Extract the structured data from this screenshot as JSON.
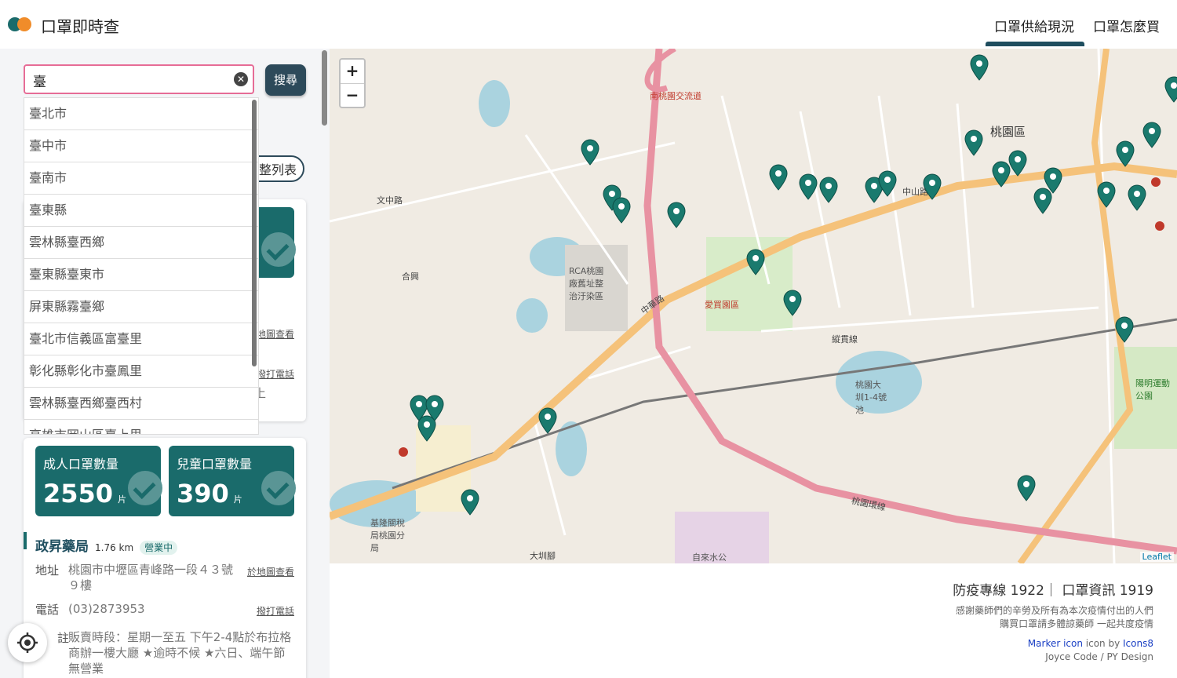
{
  "app": {
    "title": "口罩即時查"
  },
  "nav": {
    "items": [
      "口罩供給現況",
      "口罩怎麼買"
    ]
  },
  "search": {
    "value": "臺",
    "button_label": "搜尋"
  },
  "autocomplete": {
    "items": [
      "臺北市",
      "臺中市",
      "臺南市",
      "臺東縣",
      "雲林縣臺西鄉",
      "臺東縣臺東市",
      "屏東縣霧臺鄉",
      "臺北市信義區富臺里",
      "彰化縣彰化市臺鳳里",
      "雲林縣臺西鄉臺西村",
      "高雄市岡山區臺上里"
    ]
  },
  "list_toggle": {
    "label": "整列表"
  },
  "partial_card": {
    "map_link": "地圖查看",
    "call_link": "撥打電話",
    "note_tail": "上"
  },
  "pharmacy": {
    "adult_label": "成人口罩數量",
    "adult_count": "2550",
    "child_label": "兒童口罩數量",
    "child_count": "390",
    "unit": "片",
    "name": "政昇藥局",
    "distance": "1.76 km",
    "status": "營業中",
    "address_label": "地址",
    "address": "桃園市中壢區青峰路一段４３號９樓",
    "map_link": "於地圖查看",
    "phone_label": "電話",
    "phone": "(03)2873953",
    "call_link": "撥打電話",
    "note_label": "註",
    "note": "販賣時段：星期一至五 下午2-4點於布拉格商辦一樓大廳 ★逾時不候 ★六日、端午節無營業"
  },
  "map": {
    "zoom_in": "+",
    "zoom_out": "−",
    "attribution": "Leaflet",
    "labels": [
      "桃園區",
      "中山路",
      "中華路",
      "桃園環線",
      "縱貫線",
      "南桃園交流道",
      "RCA桃園廠舊址整治汙染區",
      "桃園大圳1-4號池",
      "愛買園區",
      "文中路",
      "合興",
      "大圳腳",
      "陽明運動公園",
      "基隆關稅局桃園分局",
      "自來水公"
    ],
    "markers": 34
  },
  "footer": {
    "hotline": "防疫專線 1922｜ 口罩資訊 1919",
    "thanks_1": "感謝藥師們的辛勞及所有為本次疫情付出的人們",
    "thanks_2": "購買口罩請多體諒藥師 一起共度疫情",
    "credit_marker": "Marker icon",
    "credit_by": " icon by ",
    "credit_icons8": "Icons8",
    "credit_design": "Joyce Code / PY Design"
  }
}
